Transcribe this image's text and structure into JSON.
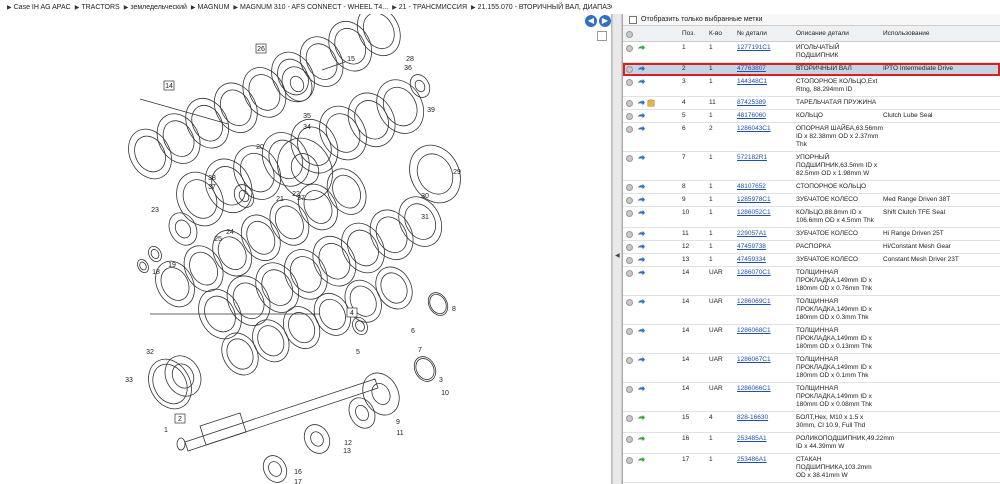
{
  "breadcrumb": [
    "Case IH AG APAC",
    "TRACTORS",
    "земледельческий",
    "MAGNUM",
    "MAGNUM 310 - AFS CONNECT - WHEEL T4...",
    "21 - ТРАНСМИССИЯ",
    "21.155.070 - ВТОРИЧНЫЙ ВАЛ, ДИАПАЗОН"
  ],
  "filter": {
    "label": "Отобразить только выбранные метки"
  },
  "table": {
    "headers": {
      "pos": "Поз.",
      "qty": "К-во",
      "num": "№ детали",
      "desc": "Описание детали",
      "use": "Использование"
    },
    "rows": [
      {
        "pos": "1",
        "qty": "1",
        "num": "1277191C1",
        "desc": "ИГОЛЬЧАТЫЙ ПОДШИПНИК",
        "use": "",
        "icon": "green-arrow",
        "selected": false
      },
      {
        "pos": "2",
        "qty": "1",
        "num": "47763807",
        "desc": "ВТОРИЧНЫЙ ВАЛ",
        "use": "IPTO Intermediate Drive",
        "icon": "blue-arrow",
        "selected": true
      },
      {
        "pos": "3",
        "qty": "1",
        "num": "144348C1",
        "desc": "СТОПОРНОЕ КОЛЬЦО,Ext Rtng, 88.294mm ID",
        "use": "",
        "icon": "blue-arrow",
        "selected": false
      },
      {
        "pos": "4",
        "qty": "11",
        "num": "87425389",
        "desc": "ТАРЕЛЬЧАТАЯ ПРУЖИНА",
        "use": "",
        "icon": "blue-arrow",
        "extra": "box",
        "selected": false
      },
      {
        "pos": "5",
        "qty": "1",
        "num": "48176060",
        "desc": "КОЛЬЦО",
        "use": "Clutch Lube Seal",
        "icon": "blue-arrow",
        "selected": false
      },
      {
        "pos": "6",
        "qty": "2",
        "num": "1286043C1",
        "desc": "ОПОРНАЯ ШАЙБА,63.56mm ID x 82.38mm OD x 2.37mm Thk",
        "use": "",
        "icon": "blue-arrow",
        "selected": false
      },
      {
        "pos": "7",
        "qty": "1",
        "num": "572182R1",
        "desc": "УПОРНЫЙ ПОДШИПНИК,63.5mm ID x 82.5mm OD x 1.98mm W",
        "use": "",
        "icon": "blue-arrow",
        "selected": false
      },
      {
        "pos": "8",
        "qty": "1",
        "num": "48107652",
        "desc": "СТОПОРНОЕ КОЛЬЦО",
        "use": "",
        "icon": "blue-arrow",
        "selected": false
      },
      {
        "pos": "9",
        "qty": "1",
        "num": "1285978C1",
        "desc": "ЗУБЧАТОЕ КОЛЕСО",
        "use": "Med Range Driven 38T",
        "icon": "blue-arrow",
        "selected": false
      },
      {
        "pos": "10",
        "qty": "1",
        "num": "1286052C1",
        "desc": "КОЛЬЦО,88.8mm ID x 106.6mm OD x 4.5mm Thk",
        "use": "Shift Clutch TFE Seal",
        "icon": "blue-arrow",
        "selected": false
      },
      {
        "pos": "11",
        "qty": "1",
        "num": "229057A1",
        "desc": "ЗУБЧАТОЕ КОЛЕСО",
        "use": "Hi Range Driven 25T",
        "icon": "blue-arrow",
        "selected": false
      },
      {
        "pos": "12",
        "qty": "1",
        "num": "47459738",
        "desc": "РАСПОРКА",
        "use": "Hi/Constant Mesh Gear",
        "icon": "blue-arrow",
        "selected": false
      },
      {
        "pos": "13",
        "qty": "1",
        "num": "47459334",
        "desc": "ЗУБЧАТОЕ КОЛЕСО",
        "use": "Constant Mesh Driver 23T",
        "icon": "blue-arrow",
        "selected": false
      },
      {
        "pos": "14",
        "qty": "UAR",
        "num": "1286070C1",
        "desc": "ТОЛЩИННАЯ ПРОКЛАДКА,149mm ID x 180mm OD x 0.76mm Thk",
        "use": "",
        "icon": "blue-arrow",
        "selected": false
      },
      {
        "pos": "14",
        "qty": "UAR",
        "num": "1286069C1",
        "desc": "ТОЛЩИННАЯ ПРОКЛАДКА,149mm ID x 180mm OD x 0.3mm Thk",
        "use": "",
        "icon": "blue-arrow",
        "selected": false
      },
      {
        "pos": "14",
        "qty": "UAR",
        "num": "1286068C1",
        "desc": "ТОЛЩИННАЯ ПРОКЛАДКА,149mm ID x 180mm OD x 0.13mm Thk",
        "use": "",
        "icon": "blue-arrow",
        "selected": false
      },
      {
        "pos": "14",
        "qty": "UAR",
        "num": "1286067C1",
        "desc": "ТОЛЩИННАЯ ПРОКЛАДКА,149mm ID x 180mm OD x 0.1mm Thk",
        "use": "",
        "icon": "blue-arrow",
        "selected": false
      },
      {
        "pos": "14",
        "qty": "UAR",
        "num": "1286066C1",
        "desc": "ТОЛЩИННАЯ ПРОКЛАДКА,149mm ID x 180mm OD x 0.08mm Thk",
        "use": "",
        "icon": "blue-arrow",
        "selected": false
      },
      {
        "pos": "15",
        "qty": "4",
        "num": "828-16630",
        "desc": "БОЛТ,Hex, M10 x 1.5 x 30mm, Cl 10.9, Full Thd",
        "use": "",
        "icon": "green-arrow",
        "selected": false
      },
      {
        "pos": "16",
        "qty": "1",
        "num": "253485A1",
        "desc": "РОЛИКОПОДШИПНИК,49.22mm ID x 44.39mm W",
        "use": "",
        "icon": "green-arrow",
        "selected": false
      },
      {
        "pos": "17",
        "qty": "1",
        "num": "253486A1",
        "desc": "СТАКАН ПОДШИПНИКА,103.2mm OD x 38.41mm W",
        "use": "",
        "icon": "green-arrow",
        "selected": false
      }
    ]
  },
  "diagram": {
    "callouts": [
      "26",
      "15",
      "14",
      "28",
      "36",
      "39",
      "35",
      "34",
      "20",
      "27",
      "29",
      "38",
      "37",
      "22",
      "21",
      "30",
      "31",
      "23",
      "24",
      "25",
      "19",
      "18",
      "8",
      "4",
      "5",
      "6",
      "7",
      "32",
      "2",
      "33",
      "3",
      "10",
      "1",
      "9",
      "11",
      "12",
      "13",
      "16",
      "17"
    ],
    "highlighted_callout": "2",
    "boxed_callouts": [
      "26",
      "14",
      "4",
      "2"
    ]
  },
  "colors": {
    "highlight": "#d92020",
    "selected_row": "#c6d4e4",
    "link": "#1f4fb0"
  }
}
